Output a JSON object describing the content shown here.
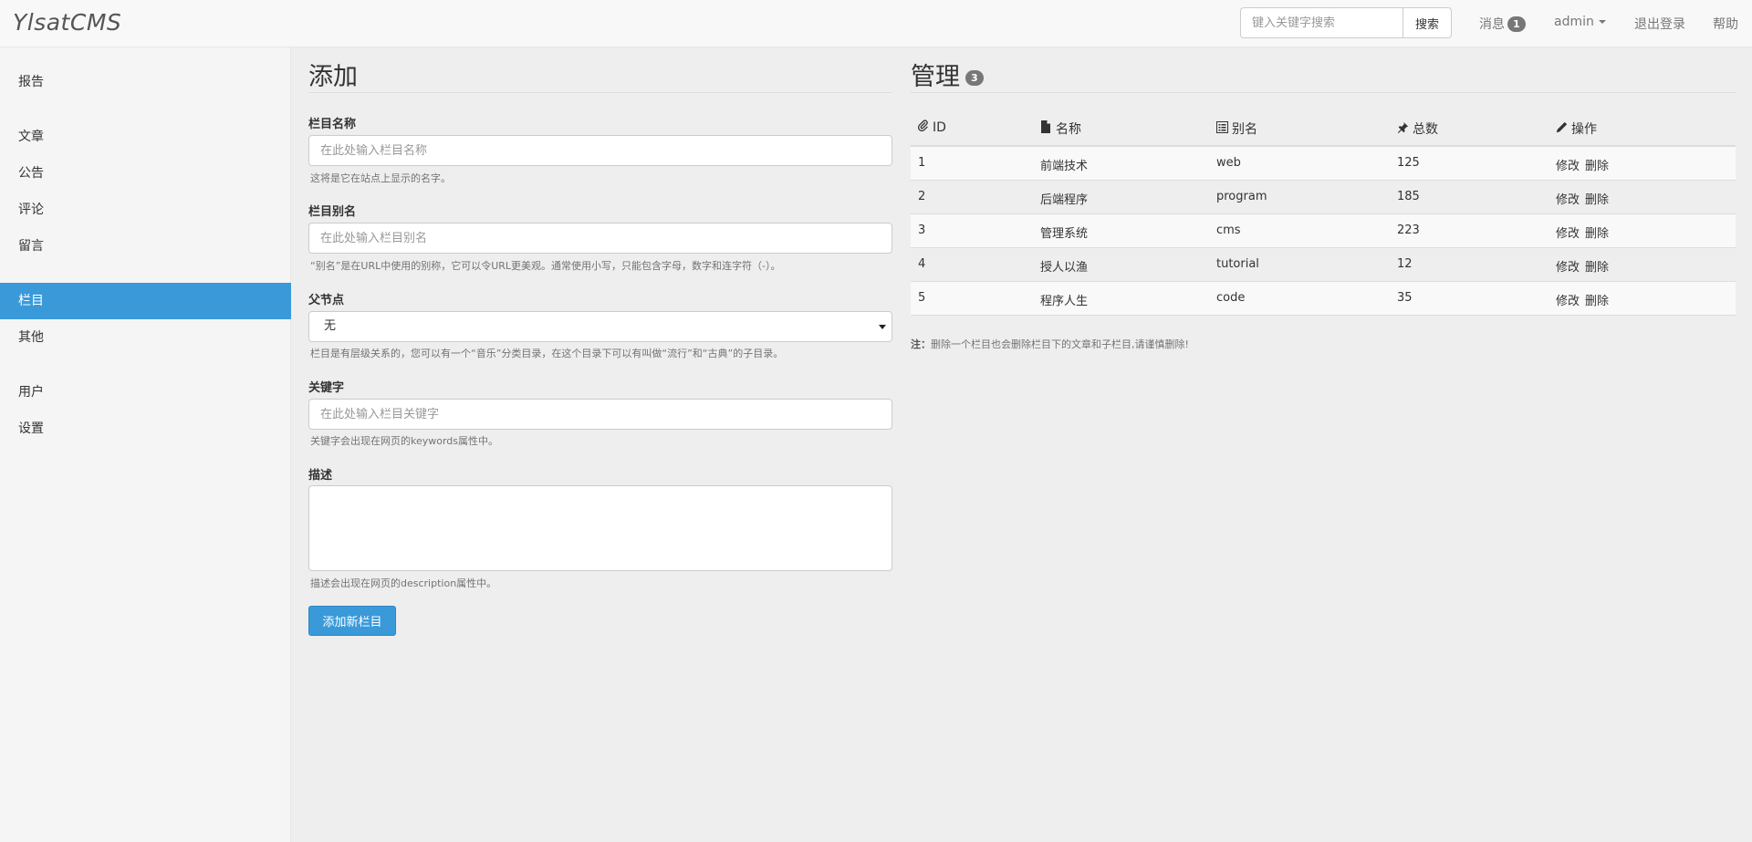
{
  "app": {
    "brand": "YlsatCMS"
  },
  "navbar": {
    "search": {
      "placeholder": "键入关键字搜索",
      "button": "搜索"
    },
    "messages": {
      "label": "消息",
      "count": "1"
    },
    "user": {
      "label": "admin"
    },
    "logout": "退出登录",
    "help": "帮助"
  },
  "sidebar": {
    "items": [
      {
        "label": "报告"
      },
      {
        "label": "文章"
      },
      {
        "label": "公告"
      },
      {
        "label": "评论"
      },
      {
        "label": "留言"
      },
      {
        "label": "栏目",
        "active": true
      },
      {
        "label": "其他"
      },
      {
        "label": "用户"
      },
      {
        "label": "设置"
      }
    ]
  },
  "add_form": {
    "title": "添加",
    "name": {
      "label": "栏目名称",
      "placeholder": "在此处输入栏目名称",
      "help": "这将是它在站点上显示的名字。"
    },
    "slug": {
      "label": "栏目别名",
      "placeholder": "在此处输入栏目别名",
      "help": "“别名”是在URL中使用的别称，它可以令URL更美观。通常使用小写，只能包含字母，数字和连字符（-）。"
    },
    "parent": {
      "label": "父节点",
      "selected": "无",
      "help": "栏目是有层级关系的，您可以有一个“音乐”分类目录，在这个目录下可以有叫做“流行”和“古典”的子目录。"
    },
    "keywords": {
      "label": "关键字",
      "placeholder": "在此处输入栏目关键字",
      "help": "关键字会出现在网页的keywords属性中。"
    },
    "description": {
      "label": "描述",
      "help": "描述会出现在网页的description属性中。"
    },
    "submit": "添加新栏目"
  },
  "manage": {
    "title": "管理",
    "count": "3",
    "columns": [
      "ID",
      "名称",
      "别名",
      "总数",
      "操作"
    ],
    "rows": [
      {
        "id": "1",
        "name": "前端技术",
        "slug": "web",
        "total": "125",
        "edit": "修改",
        "delete": "删除"
      },
      {
        "id": "2",
        "name": "后端程序",
        "slug": "program",
        "total": "185",
        "edit": "修改",
        "delete": "删除"
      },
      {
        "id": "3",
        "name": "管理系统",
        "slug": "cms",
        "total": "223",
        "edit": "修改",
        "delete": "删除"
      },
      {
        "id": "4",
        "name": "授人以渔",
        "slug": "tutorial",
        "total": "12",
        "edit": "修改",
        "delete": "删除"
      },
      {
        "id": "5",
        "name": "程序人生",
        "slug": "code",
        "total": "35",
        "edit": "修改",
        "delete": "删除"
      }
    ],
    "note_prefix": "注：",
    "note": "删除一个栏目也会删除栏目下的文章和子栏目,请谨慎删除!"
  },
  "icons": {
    "id": "paperclip-icon",
    "name": "file-icon",
    "slug": "list-alt-icon",
    "total": "pushpin-icon",
    "action": "pencil-icon"
  },
  "colors": {
    "accent": "#3a9ad9",
    "badge": "#777777"
  }
}
